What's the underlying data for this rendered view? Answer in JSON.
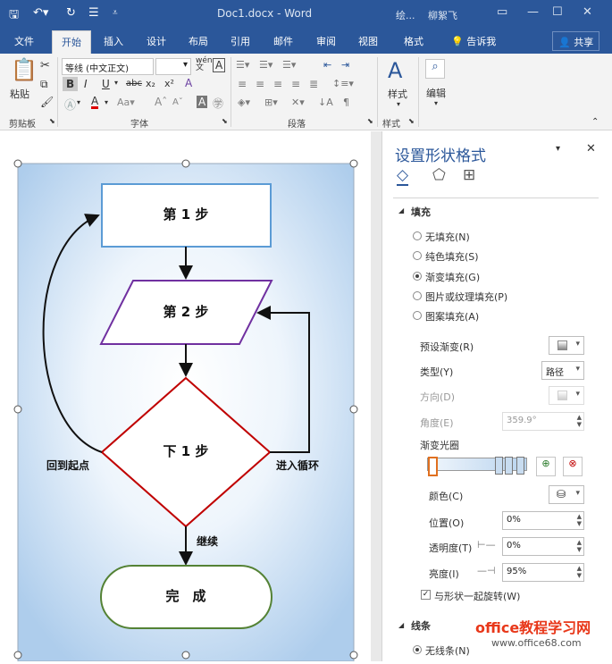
{
  "titlebar": {
    "title": "Doc1.docx - Word",
    "context": "绘...",
    "user": "柳絮飞"
  },
  "tabs": [
    "文件",
    "开始",
    "插入",
    "设计",
    "布局",
    "引用",
    "邮件",
    "审阅",
    "视图",
    "格式"
  ],
  "tellme": "告诉我",
  "share": "共享",
  "ribbon": {
    "paste": "粘贴",
    "clipboard": "剪贴板",
    "font_name": "等线 (中文正文)",
    "font": "字体",
    "paragraph": "段落",
    "styles_btn": "样式",
    "styles": "样式",
    "edit": "编辑",
    "bold": "B",
    "italic": "I",
    "underline": "U",
    "strike": "abc",
    "sub": "x₂",
    "sup": "x²",
    "wen": "wén",
    "A": "A"
  },
  "flow": {
    "step1": "第 1 步",
    "step2": "第 2 步",
    "next": "下 1 步",
    "done": "完　成",
    "back": "回到起点",
    "loop": "进入循环",
    "continue": "继续"
  },
  "pane": {
    "title": "设置形状格式",
    "fill": "填充",
    "nofill": "无填充(N)",
    "solid": "纯色填充(S)",
    "gradient": "渐变填充(G)",
    "picture": "图片或纹理填充(P)",
    "pattern": "图案填充(A)",
    "preset": "预设渐变(R)",
    "type": "类型(Y)",
    "type_val": "路径",
    "direction": "方向(D)",
    "angle": "角度(E)",
    "angle_val": "359.9°",
    "stops": "渐变光圈",
    "color": "颜色(C)",
    "position": "位置(O)",
    "position_val": "0%",
    "transparency": "透明度(T)",
    "transparency_val": "0%",
    "brightness": "亮度(I)",
    "brightness_val": "95%",
    "rotate": "与形状一起旋转(W)",
    "line": "线条",
    "noline": "无线条(N)"
  },
  "watermark": {
    "line1": "office教程学习网",
    "line2": "www.office68.com"
  }
}
